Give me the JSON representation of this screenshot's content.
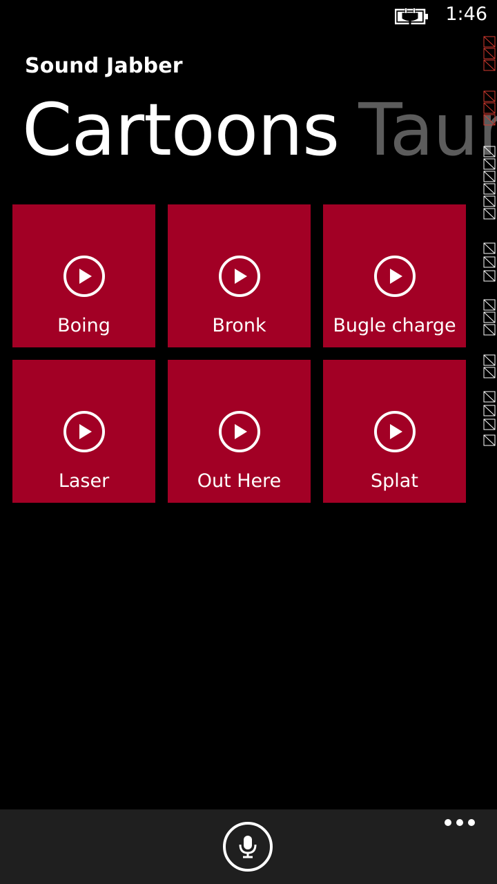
{
  "status_bar": {
    "time": "1:46",
    "battery_icon": "battery-charging-icon"
  },
  "app": {
    "title": "Sound Jabber"
  },
  "pivot": {
    "active": "Cartoons",
    "next": "Taun"
  },
  "tiles": [
    {
      "label": "Boing",
      "icon": "play-icon"
    },
    {
      "label": "Bronk",
      "icon": "play-icon"
    },
    {
      "label": "Bugle charge",
      "icon": "play-icon"
    },
    {
      "label": "Laser",
      "icon": "play-icon"
    },
    {
      "label": "Out Here",
      "icon": "play-icon"
    },
    {
      "label": "Splat",
      "icon": "play-icon"
    }
  ],
  "app_bar": {
    "mic_icon": "microphone-icon",
    "more_icon": "more-dots-icon"
  },
  "colors": {
    "tile_accent": "#a20025",
    "background": "#000000",
    "app_bar": "#1f1f1f",
    "inactive_pivot": "#5c5c5c"
  }
}
